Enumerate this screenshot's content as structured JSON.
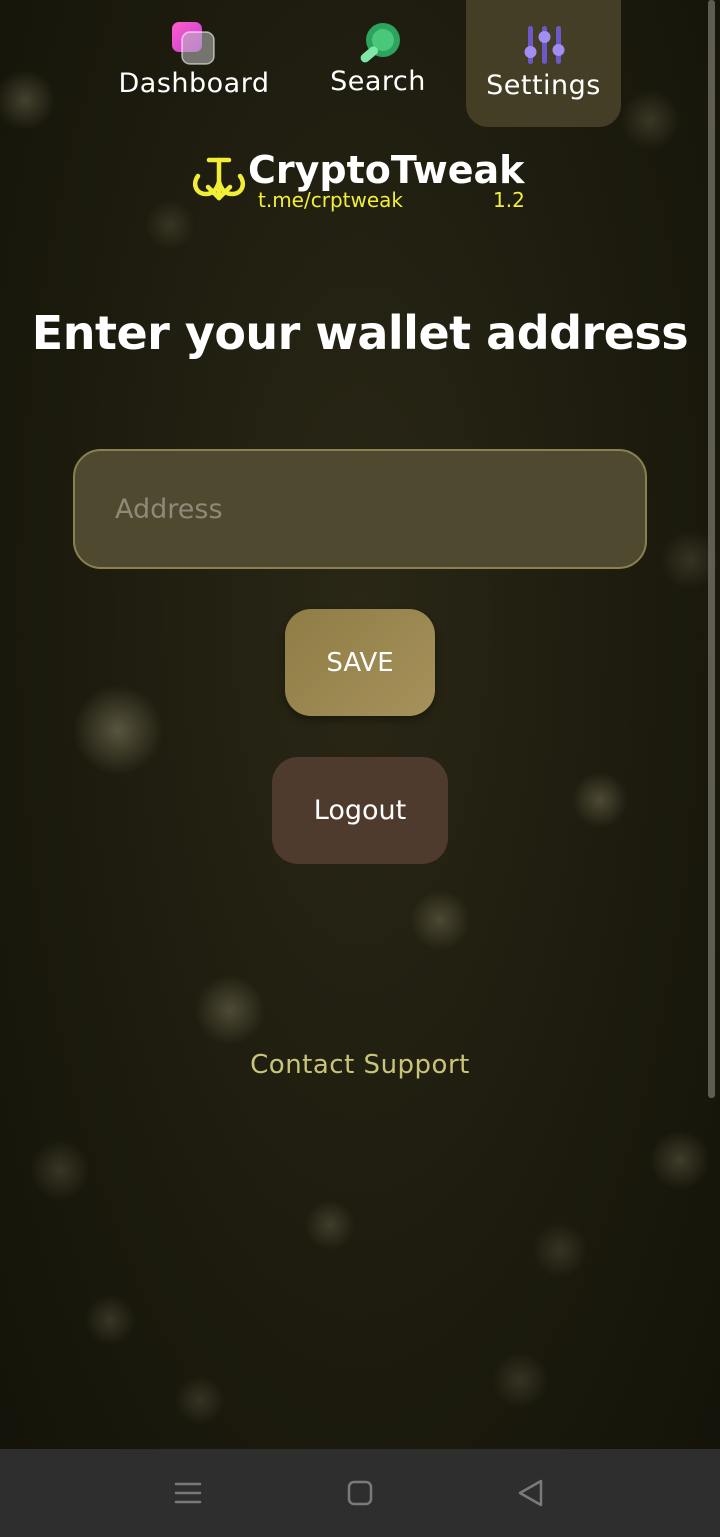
{
  "nav": {
    "items": [
      {
        "label": "Dashboard",
        "icon": "dashboard-icon"
      },
      {
        "label": "Search",
        "icon": "search-icon"
      },
      {
        "label": "Settings",
        "icon": "settings-sliders-icon",
        "active": true
      }
    ]
  },
  "brand": {
    "title": "CryptoTweak",
    "link": "t.me/crptweak",
    "version": "1.2",
    "accent": "#f2ee37"
  },
  "main": {
    "heading": "Enter your wallet address",
    "address_input": {
      "value": "",
      "placeholder": "Address"
    },
    "save_label": "SAVE",
    "logout_label": "Logout",
    "support_label": "Contact Support"
  },
  "system_nav": {
    "icons": [
      "menu-icon",
      "home-square-icon",
      "back-triangle-icon"
    ]
  },
  "colors": {
    "background": "#1d1b0e",
    "input_bg": "#4f4930",
    "save_bg": "#a6915a",
    "logout_bg": "#4f3b2d",
    "support_text": "#c9c47a"
  }
}
